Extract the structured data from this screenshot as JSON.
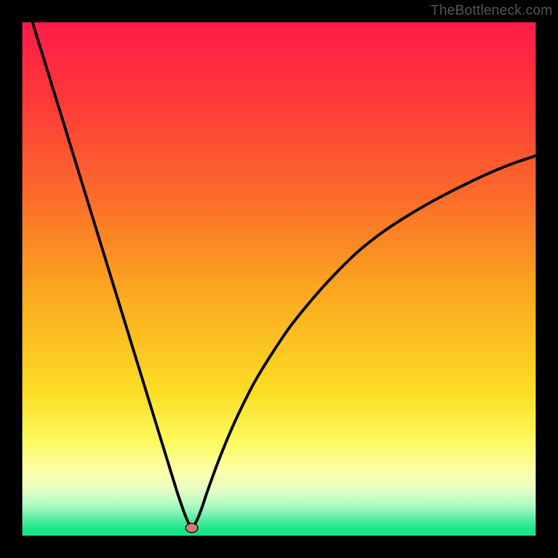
{
  "watermark": "TheBottleneck.com",
  "colors": {
    "frame_bg": "#000000",
    "gradient": [
      {
        "offset": 0.0,
        "hex": "#ff1b48"
      },
      {
        "offset": 0.16,
        "hex": "#fd3b38"
      },
      {
        "offset": 0.34,
        "hex": "#fb6c2a"
      },
      {
        "offset": 0.53,
        "hex": "#fba91f"
      },
      {
        "offset": 0.72,
        "hex": "#fcdd24"
      },
      {
        "offset": 0.82,
        "hex": "#fefb62"
      },
      {
        "offset": 0.87,
        "hex": "#fefda6"
      },
      {
        "offset": 0.91,
        "hex": "#e7fec3"
      },
      {
        "offset": 0.945,
        "hex": "#a5f8c1"
      },
      {
        "offset": 0.967,
        "hex": "#57eea3"
      },
      {
        "offset": 0.985,
        "hex": "#1fe788"
      },
      {
        "offset": 1.0,
        "hex": "#17e381"
      }
    ],
    "curve": "#000000",
    "marker_fill": "#cf7c77",
    "marker_stroke": "#000000"
  },
  "chart_data": {
    "type": "line",
    "title": "",
    "xlabel": "",
    "ylabel": "",
    "x_range": [
      0,
      100
    ],
    "y_range": [
      0,
      100
    ],
    "grid": false,
    "legend": false,
    "curve_min": {
      "x": 33.0,
      "y": 1.5
    },
    "series": [
      {
        "name": "bottleneck-curve",
        "x": [
          0,
          2,
          4,
          6,
          8,
          10,
          12,
          14,
          16,
          18,
          20,
          22,
          24,
          26,
          28,
          30,
          31,
          32,
          33,
          34,
          35,
          36,
          38,
          40,
          42,
          45,
          48,
          52,
          56,
          60,
          65,
          70,
          75,
          80,
          85,
          90,
          95,
          100
        ],
        "y": [
          107,
          100,
          93.5,
          87,
          80.5,
          74,
          67.5,
          61,
          54.5,
          48,
          41.5,
          35,
          28.5,
          22,
          15.5,
          9,
          6.0,
          3.3,
          1.5,
          3.0,
          5.5,
          8.5,
          14.0,
          19.0,
          23.5,
          29.5,
          34.5,
          40.5,
          45.5,
          50.0,
          55.0,
          59.0,
          62.3,
          65.2,
          67.8,
          70.2,
          72.3,
          74.0
        ]
      }
    ],
    "marker": {
      "x": 33.0,
      "y": 1.5,
      "rx": 1.2,
      "ry": 0.9
    }
  }
}
